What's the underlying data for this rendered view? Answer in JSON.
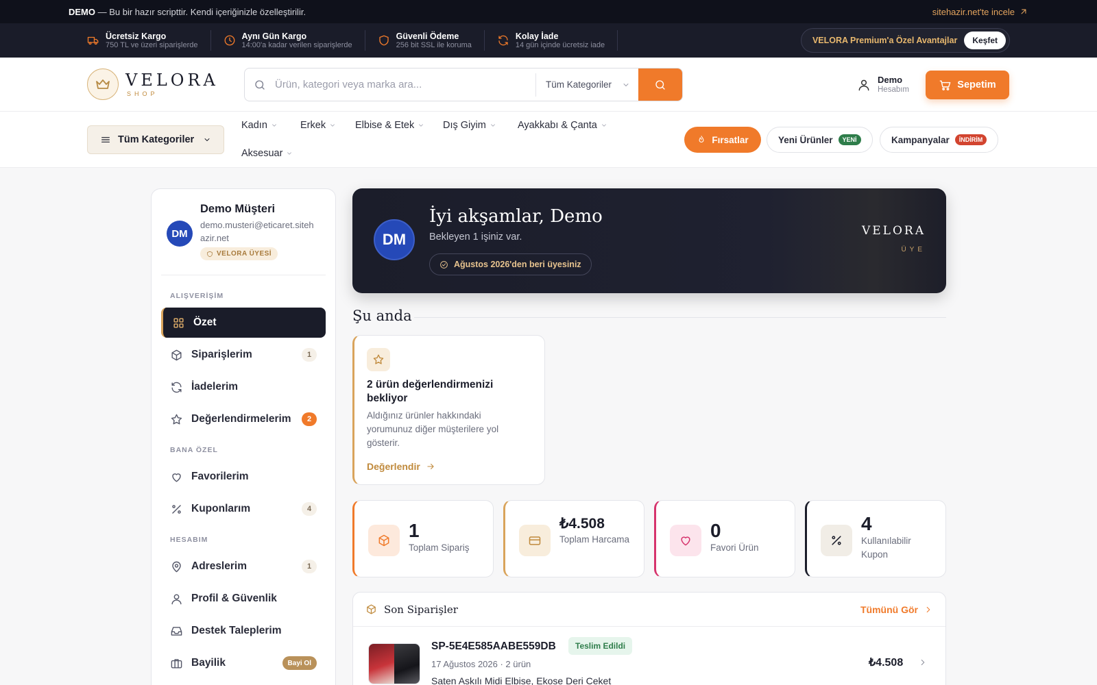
{
  "demo_bar": {
    "strong": "DEMO",
    "text": "— Bu bir hazır scripttir. Kendi içeriğinizle özelleştirilir.",
    "link": "sitehazir.net'te incele"
  },
  "features": [
    {
      "title": "Ücretsiz Kargo",
      "sub": "750 TL ve üzeri siparişlerde",
      "icon": "truck-icon"
    },
    {
      "title": "Aynı Gün Kargo",
      "sub": "14:00'a kadar verilen siparişlerde",
      "icon": "clock-icon"
    },
    {
      "title": "Güvenli Ödeme",
      "sub": "256 bit SSL ile koruma",
      "icon": "shield-icon"
    },
    {
      "title": "Kolay İade",
      "sub": "14 gün içinde ücretsiz iade",
      "icon": "refresh-icon"
    }
  ],
  "premium": {
    "text": "VELORA Premium'a Özel Avantajlar",
    "button": "Keşfet"
  },
  "brand": {
    "name": "VELORA",
    "sub": "SHOP"
  },
  "search": {
    "placeholder": "Ürün, kategori veya marka ara...",
    "category": "Tüm Kategoriler"
  },
  "account": {
    "name": "Demo",
    "sub": "Hesabım"
  },
  "cart": {
    "label": "Sepetim"
  },
  "nav": {
    "all_categories": "Tüm Kategoriler",
    "links": [
      "Kadın",
      "Erkek",
      "Elbise & Etek",
      "Dış Giyim",
      "Ayakkabı & Çanta",
      "Aksesuar"
    ],
    "deals": "Fırsatlar",
    "new_products": "Yeni Ürünler",
    "new_tag": "YENİ",
    "campaigns": "Kampanyalar",
    "discount_tag": "İNDİRİM"
  },
  "sidebar": {
    "initials": "DM",
    "name": "Demo Müşteri",
    "email": "demo.musteri@eticaret.sitehazir.net",
    "badge": "VELORA ÜYESİ",
    "sections": {
      "shopping": "ALIŞVERİŞİM",
      "special": "BANA ÖZEL",
      "account": "HESABIM"
    },
    "items": [
      {
        "label": "Özet"
      },
      {
        "label": "Siparişlerim",
        "count": "1"
      },
      {
        "label": "İadelerim"
      },
      {
        "label": "Değerlendirmelerim",
        "count": "2"
      },
      {
        "label": "Favorilerim"
      },
      {
        "label": "Kuponlarım",
        "count": "4"
      },
      {
        "label": "Adreslerim",
        "count": "1"
      },
      {
        "label": "Profil & Güvenlik"
      },
      {
        "label": "Destek Taleplerim"
      },
      {
        "label": "Bayilik",
        "count": "Bayi Ol"
      }
    ]
  },
  "hero": {
    "initials": "DM",
    "greeting": "İyi akşamlar, Demo",
    "sub": "Bekleyen 1 işiniz var.",
    "badge": "Ağustos 2026'den beri üyesiniz",
    "brand": "VELORA",
    "brand_sub": "ÜYE"
  },
  "now": {
    "title": "Şu anda",
    "task_title": "2 ürün değerlendirmenizi bekliyor",
    "task_desc": "Aldığınız ürünler hakkındaki yorumunuz diğer müşterilere yol gösterir.",
    "task_link": "Değerlendir"
  },
  "stats": [
    {
      "value": "1",
      "label": "Toplam Sipariş",
      "accent": "#f07a2a"
    },
    {
      "value": "₺4.508",
      "label": "Toplam Harcama",
      "accent": "#d9a45c"
    },
    {
      "value": "0",
      "label": "Favori Ürün",
      "accent": "#d6336c"
    },
    {
      "value": "4",
      "label": "Kullanılabilir Kupon",
      "accent": "#1b1d2a"
    }
  ],
  "orders": {
    "title": "Son Siparişler",
    "see_all": "Tümünü Gör",
    "latest": {
      "id": "SP-5E4E585AABE559DB",
      "status": "Teslim Edildi",
      "meta": "17 Ağustos 2026 · 2 ürün",
      "items": "Saten Askılı Midi Elbise, Ekose Deri Ceket",
      "price": "₺4.508"
    }
  },
  "colors": {
    "accent": "#f07a2a",
    "gold": "#d9a45c",
    "dark": "#1a1c29"
  }
}
